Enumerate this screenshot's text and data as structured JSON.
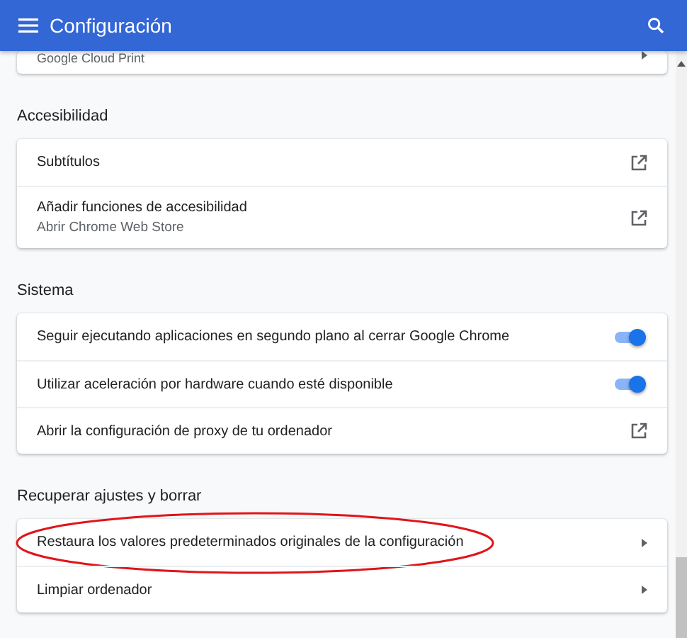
{
  "header": {
    "title": "Configuración"
  },
  "sections": [
    {
      "partial": true,
      "items": [
        {
          "kind": "arrow",
          "label": "Google Cloud Print"
        }
      ]
    },
    {
      "heading": "Accesibilidad",
      "items": [
        {
          "kind": "external",
          "label": "Subtítulos"
        },
        {
          "kind": "external",
          "label": "Añadir funciones de accesibilidad",
          "sublabel": "Abrir Chrome Web Store"
        }
      ]
    },
    {
      "heading": "Sistema",
      "items": [
        {
          "kind": "toggle",
          "label": "Seguir ejecutando aplicaciones en segundo plano al cerrar Google Chrome",
          "on": true
        },
        {
          "kind": "toggle",
          "label": "Utilizar aceleración por hardware cuando esté disponible",
          "on": true
        },
        {
          "kind": "external",
          "label": "Abrir la configuración de proxy de tu ordenador"
        }
      ]
    },
    {
      "heading": "Recuperar ajustes y borrar",
      "items": [
        {
          "kind": "arrow",
          "label": "Restaura los valores predeterminados originales de la configuración",
          "highlighted": true
        },
        {
          "kind": "arrow",
          "label": "Limpiar ordenador"
        }
      ]
    }
  ]
}
